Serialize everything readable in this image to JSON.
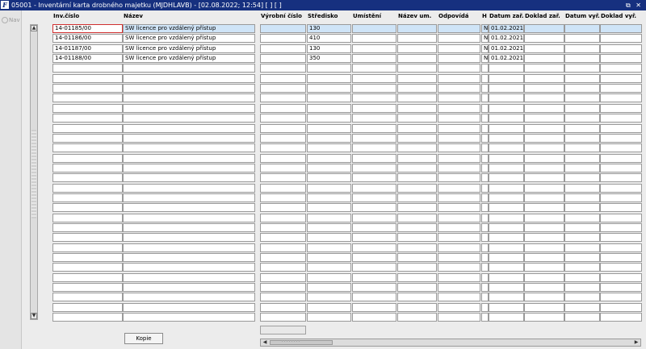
{
  "window": {
    "icon_glyph": "F",
    "title": "05001 - Inventární karta drobného majetku (MJDHLAVB) - [02.08.2022; 12:54]  [ ]  [ ]",
    "controls": "⧉ ✕"
  },
  "nav": {
    "label": "Nav"
  },
  "grid": {
    "headers": {
      "inv_cislo": "Inv.číslo",
      "nazev": "Název",
      "vyrobni_cislo": "Výrobní číslo",
      "stredisko": "Středisko",
      "umisteni": "Umístění",
      "nazev_um": "Název um.",
      "odpovida": "Odpovídá",
      "h": "H",
      "datum_zar": "Datum zař.",
      "doklad_zar": "Doklad zař.",
      "datum_vyr": "Datum vyř.",
      "doklad_vyr": "Doklad vyř."
    },
    "rows": [
      {
        "inv_cislo": "14-01185/00",
        "nazev": "SW licence pro vzdálený přístup",
        "vyrobni_cislo": "",
        "stredisko": "130",
        "umisteni": "",
        "nazev_um": "",
        "odpovida": "",
        "h": "N",
        "datum_zar": "01.02.2021",
        "doklad_zar": "",
        "datum_vyr": "",
        "doklad_vyr": ""
      },
      {
        "inv_cislo": "14-01186/00",
        "nazev": "SW licence pro vzdálený přístup",
        "vyrobni_cislo": "",
        "stredisko": "410",
        "umisteni": "",
        "nazev_um": "",
        "odpovida": "",
        "h": "N",
        "datum_zar": "01.02.2021",
        "doklad_zar": "",
        "datum_vyr": "",
        "doklad_vyr": ""
      },
      {
        "inv_cislo": "14-01187/00",
        "nazev": "SW licence pro vzdálený přístup",
        "vyrobni_cislo": "",
        "stredisko": "130",
        "umisteni": "",
        "nazev_um": "",
        "odpovida": "",
        "h": "N",
        "datum_zar": "01.02.2021",
        "doklad_zar": "",
        "datum_vyr": "",
        "doklad_vyr": ""
      },
      {
        "inv_cislo": "14-01188/00",
        "nazev": "SW licence pro vzdálený přístup",
        "vyrobni_cislo": "",
        "stredisko": "350",
        "umisteni": "",
        "nazev_um": "",
        "odpovida": "",
        "h": "N",
        "datum_zar": "01.02.2021",
        "doklad_zar": "",
        "datum_vyr": "",
        "doklad_vyr": ""
      }
    ],
    "empty_rows_count": 26,
    "selected_row": 0
  },
  "buttons": {
    "copy_label": "Kopie"
  },
  "colors": {
    "titlebar": "#16307f",
    "selected_row": "#cfe4f7",
    "focus_border": "#d03030"
  }
}
